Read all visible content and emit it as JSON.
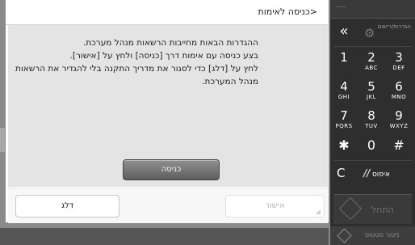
{
  "dialog": {
    "title": "<כניסה לאימות",
    "message_lines": [
      "ההגדרות הבאות מחייבות הרשאות מנהל מערכת.",
      "בצע כניסה עם אימות דרך [כניסה] ולחץ על [אישור].",
      "לחץ על [דלג] כדי לסגור את מדריך התקנה בלי להגדיר את הרשאות",
      "מנהל המערכת."
    ],
    "login_button": "כניסה",
    "skip_button": "דלג",
    "ok_button": "אישור"
  },
  "keypad": {
    "top_indicator": "......",
    "back_icon": "double-chevron-left-icon",
    "back_glyph": "«",
    "settings_icon": "gear-icon",
    "settings_label": "הגדרות/רישום",
    "keys": [
      {
        "digit": "1",
        "letters": ""
      },
      {
        "digit": "2",
        "letters": "ABC"
      },
      {
        "digit": "3",
        "letters": "DEF"
      },
      {
        "digit": "4",
        "letters": "GHI"
      },
      {
        "digit": "5",
        "letters": "JKL"
      },
      {
        "digit": "6",
        "letters": "MNO"
      },
      {
        "digit": "7",
        "letters": "PQRS"
      },
      {
        "digit": "8",
        "letters": "TUV"
      },
      {
        "digit": "9",
        "letters": "WXYZ"
      },
      {
        "digit": "✱",
        "letters": ""
      },
      {
        "digit": "0",
        "letters": ""
      },
      {
        "digit": "#",
        "letters": ""
      }
    ],
    "clear_key": "C",
    "reset_key": "איפוס",
    "start_label": "התחל",
    "status_monitor_label": "ניטור סטטוס"
  }
}
